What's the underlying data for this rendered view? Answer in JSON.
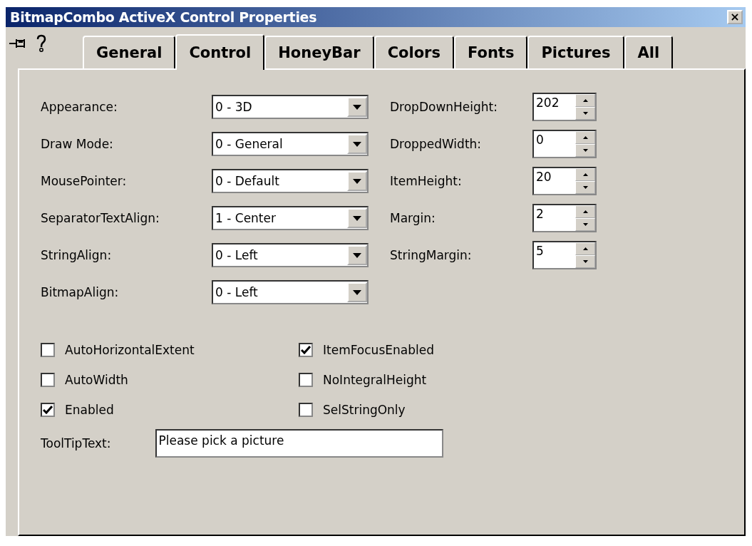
{
  "window": {
    "title": "BitmapCombo ActiveX Control Properties",
    "close": "×"
  },
  "tabs": [
    {
      "label": "General",
      "selected": false
    },
    {
      "label": "Control",
      "selected": true
    },
    {
      "label": "HoneyBar",
      "selected": false
    },
    {
      "label": "Colors",
      "selected": false
    },
    {
      "label": "Fonts",
      "selected": false
    },
    {
      "label": "Pictures",
      "selected": false
    },
    {
      "label": "All",
      "selected": false
    }
  ],
  "dropdowns": [
    {
      "label": "Appearance:",
      "value": "0 - 3D"
    },
    {
      "label": "Draw Mode:",
      "value": "0 - General"
    },
    {
      "label": "MousePointer:",
      "value": "0 - Default"
    },
    {
      "label": "SeparatorTextAlign:",
      "value": "1 - Center"
    },
    {
      "label": "StringAlign:",
      "value": "0 - Left"
    },
    {
      "label": "BitmapAlign:",
      "value": "0 - Left"
    }
  ],
  "spinners": [
    {
      "label": "DropDownHeight:",
      "value": "202"
    },
    {
      "label": "DroppedWidth:",
      "value": "0"
    },
    {
      "label": "ItemHeight:",
      "value": "20"
    },
    {
      "label": "Margin:",
      "value": "2"
    },
    {
      "label": "StringMargin:",
      "value": "5"
    }
  ],
  "checkboxes_left": [
    {
      "label": "AutoHorizontalExtent",
      "checked": false
    },
    {
      "label": "AutoWidth",
      "checked": false
    },
    {
      "label": "Enabled",
      "checked": true
    }
  ],
  "checkboxes_right": [
    {
      "label": "ItemFocusEnabled",
      "checked": true
    },
    {
      "label": "NoIntegralHeight",
      "checked": false
    },
    {
      "label": "SelStringOnly",
      "checked": false
    }
  ],
  "tooltip_field": {
    "label": "ToolTipText:",
    "value": "Please pick a picture"
  }
}
